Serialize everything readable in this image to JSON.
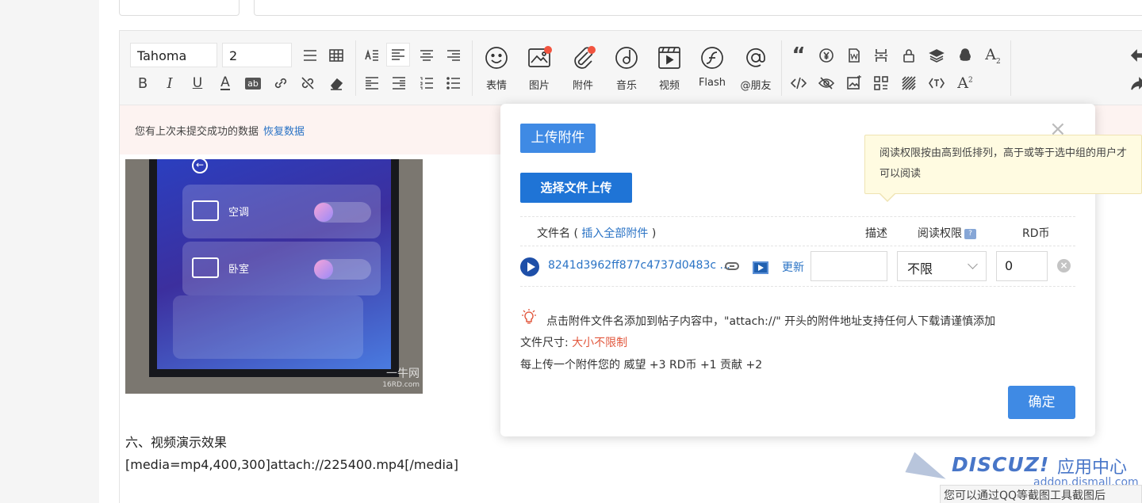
{
  "toolbar": {
    "font_family": "Tahoma",
    "font_size": "2",
    "media_buttons": [
      {
        "label": "表情",
        "icon": "smiley-icon",
        "badge": false
      },
      {
        "label": "图片",
        "icon": "image-icon",
        "badge": true
      },
      {
        "label": "附件",
        "icon": "paperclip-icon",
        "badge": true
      },
      {
        "label": "音乐",
        "icon": "music-icon",
        "badge": false
      },
      {
        "label": "视频",
        "icon": "video-icon",
        "badge": false
      },
      {
        "label": "Flash",
        "icon": "flash-icon",
        "badge": false
      },
      {
        "label": "@朋友",
        "icon": "at-icon",
        "badge": false
      }
    ]
  },
  "notice": {
    "text": "您有上次未提交成功的数据",
    "restore_link": "恢复数据"
  },
  "photo": {
    "row1_label": "空调",
    "row2_label": "卧室",
    "watermark": "一牛网",
    "watermark_sub": "16RD.com"
  },
  "content": {
    "heading": "六、视频演示效果",
    "media_code": "[media=mp4,400,300]attach://225400.mp4[/media]"
  },
  "dialog": {
    "title": "上传附件",
    "select_button": "选择文件上传",
    "tooltip": "阅读权限按由高到低排列，高于或等于选中组的用户才可以阅读",
    "columns": {
      "filename": "文件名",
      "insert_all_link": "插入全部附件",
      "description": "描述",
      "read_permission": "阅读权限",
      "permission_help": "?",
      "rd_coin": "RD币"
    },
    "row": {
      "filename": "8241d3962ff877c4737d0483c ...",
      "update_link": "更新",
      "description": "",
      "permission": "不限",
      "rd_coin": "0"
    },
    "tip": "点击附件文件名添加到帖子内容中，\"attach://\" 开头的附件地址支持任何人下载请谨慎添加",
    "size_label": "文件尺寸:",
    "size_value": "大小不限制",
    "award": "每上传一个附件您的 威望 +3  RD币 +1  贡献 +2",
    "ok_button": "确定"
  },
  "brand": {
    "logo": "DISCUZ!",
    "app_center": "应用中心",
    "domain": "addon.dismall.com",
    "help": "您可以通过QQ等截图工具截图后"
  }
}
